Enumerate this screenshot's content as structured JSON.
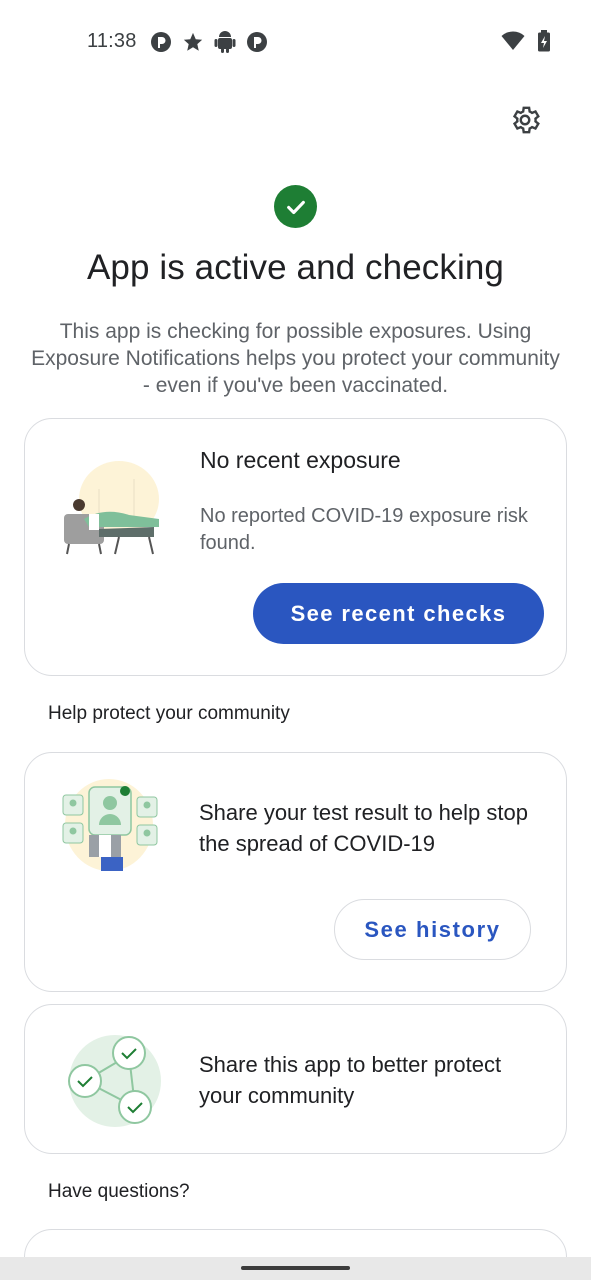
{
  "status_bar": {
    "time": "11:38",
    "left_icons": [
      "app-p-icon",
      "star-icon",
      "android-icon",
      "app-p-icon"
    ],
    "right_icons": [
      "wifi-icon",
      "battery-icon"
    ]
  },
  "header": {
    "status_title": "App is active and checking",
    "description": "This app is checking for possible exposures. Using Exposure Notifications helps you protect your community - even if you've been vaccinated."
  },
  "exposure_card": {
    "title": "No recent exposure",
    "text": "No reported COVID-19 exposure risk found.",
    "button_label": "See recent checks"
  },
  "help_section": {
    "label": "Help protect your community"
  },
  "share_result_card": {
    "text": "Share your test result to help stop the spread of COVID-19",
    "button_label": "See history"
  },
  "share_app_card": {
    "text": "Share this app to better protect your community"
  },
  "questions_section": {
    "label": "Have questions?"
  },
  "colors": {
    "accent": "#2a56c0",
    "success": "#1e7e34",
    "border": "#dadce0",
    "secondary_text": "#5f6368"
  }
}
